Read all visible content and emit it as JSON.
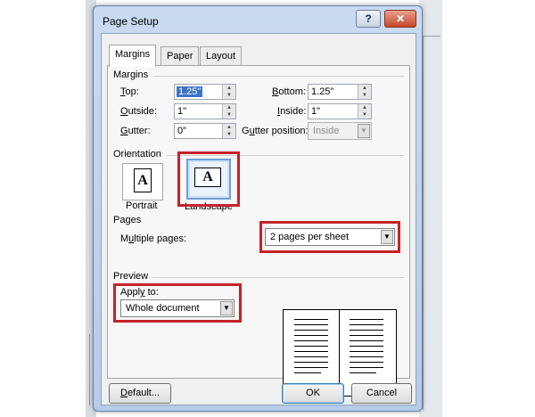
{
  "dialog": {
    "title": "Page Setup",
    "help_glyph": "?",
    "close_glyph": "✕"
  },
  "tabs": [
    {
      "label": "Margins",
      "active": true
    },
    {
      "label": "Paper",
      "active": false
    },
    {
      "label": "Layout",
      "active": false
    }
  ],
  "margins": {
    "group_title": "Margins",
    "top": {
      "label_u": "T",
      "label_rest": "op:",
      "value": "1.25\""
    },
    "bottom": {
      "label_u": "B",
      "label_rest": "ottom:",
      "value": "1.25\""
    },
    "outside": {
      "label_u": "O",
      "label_rest": "utside:",
      "value": "1\""
    },
    "inside": {
      "label_u": "I",
      "label_rest": "nside:",
      "value": "1\""
    },
    "gutter": {
      "label_u": "G",
      "label_rest": "utter:",
      "value": "0\""
    },
    "gutter_position": {
      "label_pre": "G",
      "label_u": "u",
      "label_rest": "tter position:",
      "value": "Inside"
    }
  },
  "orientation": {
    "group_title": "Orientation",
    "portrait_label": "Portrait",
    "landscape_label": "Landscape",
    "glyph": "A",
    "selected": "landscape"
  },
  "pages": {
    "group_title": "Pages",
    "multiple_label_pre": "M",
    "multiple_label_u": "u",
    "multiple_label_rest": "ltiple pages:",
    "multiple_value": "2 pages per sheet"
  },
  "preview": {
    "group_title": "Preview",
    "apply_label_pre": "Appl",
    "apply_label_u": "y",
    "apply_label_rest": " to:",
    "apply_value": "Whole document"
  },
  "buttons": {
    "default_pre": "",
    "default_u": "D",
    "default_rest": "efault...",
    "ok": "OK",
    "cancel": "Cancel"
  },
  "colors": {
    "highlight_box": "#c4222a",
    "selection": "#3f73c6",
    "title_bar": "#c9daf0"
  }
}
